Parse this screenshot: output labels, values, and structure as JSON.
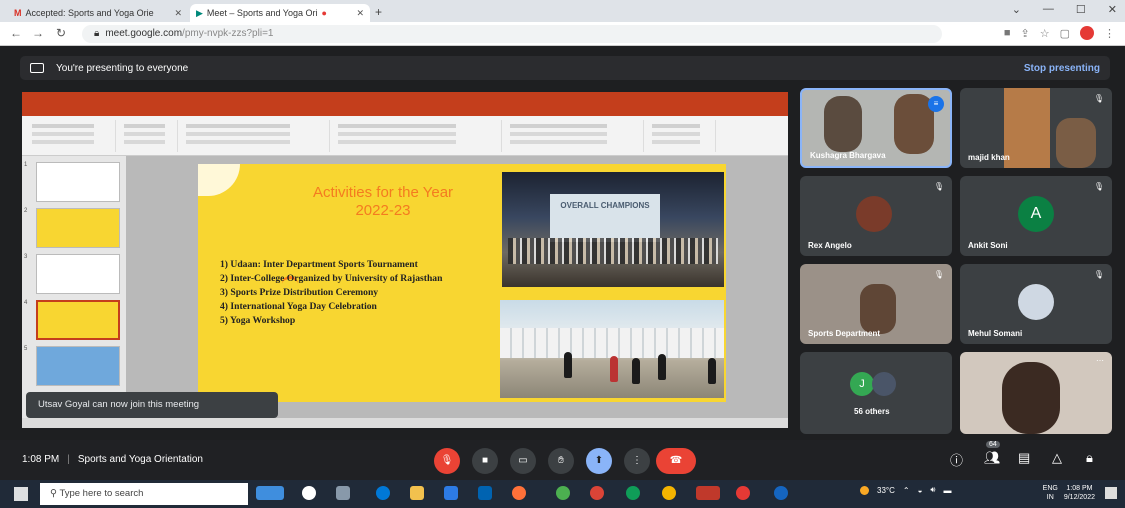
{
  "browser": {
    "tabs": [
      {
        "title": "Accepted: Sports and Yoga Orie"
      },
      {
        "title": "Meet – Sports and Yoga Ori"
      }
    ],
    "url": "meet.google.com/pmy-nvpk-zzs?pli=1",
    "url_host": "meet.google.com",
    "url_path": "/pmy-nvpk-zzs?pli=1"
  },
  "meet": {
    "presenting_text": "You're presenting to everyone",
    "stop_presenting": "Stop presenting",
    "toast": "Utsav Goyal can now join this meeting",
    "time": "1:08 PM",
    "meeting_title": "Sports and Yoga Orientation",
    "participant_count": "64",
    "participants": [
      {
        "name": "Kushagra Bhargava"
      },
      {
        "name": "majid khan"
      },
      {
        "name": "Rex Angelo"
      },
      {
        "name": "Ankit Soni",
        "initial": "A"
      },
      {
        "name": "Sports Department"
      },
      {
        "name": "Mehul Somani"
      },
      {
        "name": "56 others",
        "initial": "J"
      },
      {
        "name": ""
      }
    ]
  },
  "slide": {
    "title_line1": "Activities for the Year",
    "title_line2": "2022-23",
    "activities": [
      "1) Udaan: Inter Department Sports Tournament",
      "2) Inter-College Organized by University of Rajasthan",
      "3) Sports Prize Distribution Ceremony",
      "4) International Yoga Day Celebration",
      "5) Yoga Workshop"
    ],
    "photo1_banner": "OVERALL CHAMPIONS"
  },
  "taskbar": {
    "search_placeholder": "Type here to search",
    "weather": "33°C",
    "lang": "ENG",
    "region": "IN",
    "clock_time": "1:08 PM",
    "clock_date": "9/12/2022"
  },
  "colors": {
    "slide_bg": "#f8d631",
    "slide_title": "#f47b20",
    "leave": "#ea4335",
    "accent": "#8ab4f8"
  },
  "icons": [
    "gmail-icon",
    "meet-icon",
    "back-icon",
    "forward-icon",
    "reload-icon",
    "lock-icon",
    "mic-off-icon",
    "camera-icon",
    "captions-icon",
    "hand-icon",
    "present-icon",
    "more-icon",
    "leave-icon",
    "info-icon",
    "people-icon",
    "chat-icon",
    "activities-icon",
    "lock-host-icon",
    "windows-icon",
    "search-icon"
  ]
}
